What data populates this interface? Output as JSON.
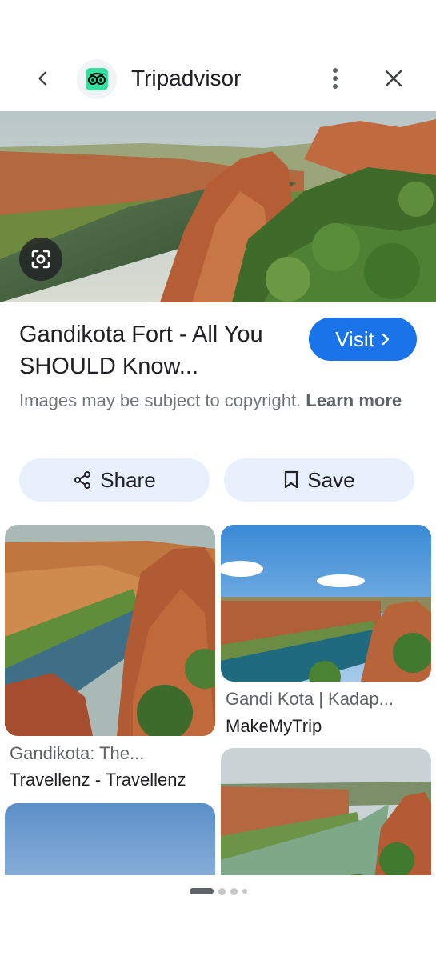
{
  "header": {
    "site_name": "Tripadvisor",
    "back_icon": "chevron-left-icon",
    "logo_icon": "tripadvisor-owl-icon",
    "more_icon": "more-vert-icon",
    "close_icon": "close-icon"
  },
  "result": {
    "title": "Gandikota Fort - All You SHOULD Know...",
    "visit_label": "Visit",
    "copyright_text": "Images may be subject to copyright.",
    "learn_more_label": "Learn more"
  },
  "actions": {
    "share_label": "Share",
    "save_label": "Save"
  },
  "related": [
    {
      "title": "Gandikota: The...",
      "source": "Travellenz - Travellenz"
    },
    {
      "title": "Gandi Kota | Kadap...",
      "source": "MakeMyTrip"
    }
  ],
  "colors": {
    "accent": "#1a73e8",
    "action_bg": "#e8f0fe",
    "logo_green": "#34e0a1"
  }
}
